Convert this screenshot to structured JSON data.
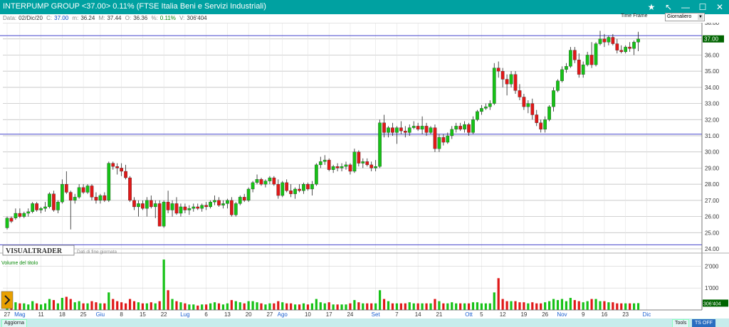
{
  "window": {
    "title": "INTERPUMP GROUP <37.00> 0.11%  (FTSE Italia Beni e Servizi Industriali)",
    "buttons": [
      {
        "name": "star-icon",
        "glyph": "★"
      },
      {
        "name": "arrow-icon",
        "glyph": "↖"
      },
      {
        "name": "minimize-icon",
        "glyph": "—"
      },
      {
        "name": "maximize-icon",
        "glyph": "☐"
      },
      {
        "name": "close-icon",
        "glyph": "✕"
      }
    ]
  },
  "info": {
    "data_label": "Data:",
    "data_value": "02/Dic/20",
    "c_label": "C:",
    "c_value": "37.00",
    "m_label": "m:",
    "m_value": "36.24",
    "mx_label": "M:",
    "mx_value": "37.44",
    "o_label": "O:",
    "o_value": "36.36",
    "pct_label": "%:",
    "pct_value": "0.11%",
    "v_label": "V:",
    "v_value": "306'404"
  },
  "timeframe": {
    "label": "Time Frame",
    "selected": "Giornaliero"
  },
  "brand": {
    "logo": "VISUALTRADER",
    "note": "Dati di fine giornata"
  },
  "bottom": {
    "aggiorna": "Aggiorna",
    "tools": "Tools",
    "tsoff": "TS OFF"
  },
  "colors": {
    "up": "#16c216",
    "down": "#e01818",
    "hline": "#4444cc",
    "grid": "#b8b8b8",
    "price_tag": "#006400",
    "vol_tag": "#006400"
  },
  "chart_data": {
    "type": "candlestick",
    "price_axis": {
      "min": 24.0,
      "max": 38.0,
      "ticks": [
        "24.00",
        "25.00",
        "26.00",
        "27.00",
        "28.00",
        "29.00",
        "30.00",
        "31.00",
        "32.00",
        "33.00",
        "34.00",
        "35.00",
        "36.00",
        "37.00",
        "38.00"
      ]
    },
    "last_price_label": "37.00",
    "horizontal_lines": [
      37.2,
      31.1,
      24.25
    ],
    "volume_panel": {
      "title": "Volume del titolo",
      "ticks": [
        "2'000",
        "1'000"
      ],
      "last_label": "306'404"
    },
    "x_labels": [
      {
        "label": "27",
        "i": 0
      },
      {
        "label": "Mag",
        "i": 3,
        "month": true
      },
      {
        "label": "11",
        "i": 8
      },
      {
        "label": "18",
        "i": 13
      },
      {
        "label": "25",
        "i": 18
      },
      {
        "label": "Giu",
        "i": 22,
        "month": true
      },
      {
        "label": "8",
        "i": 27
      },
      {
        "label": "15",
        "i": 32
      },
      {
        "label": "22",
        "i": 37
      },
      {
        "label": "Lug",
        "i": 42,
        "month": true
      },
      {
        "label": "6",
        "i": 47
      },
      {
        "label": "13",
        "i": 52
      },
      {
        "label": "20",
        "i": 57
      },
      {
        "label": "27",
        "i": 62
      },
      {
        "label": "Ago",
        "i": 65,
        "month": true
      },
      {
        "label": "10",
        "i": 71
      },
      {
        "label": "17",
        "i": 76
      },
      {
        "label": "24",
        "i": 81
      },
      {
        "label": "Set",
        "i": 87,
        "month": true
      },
      {
        "label": "7",
        "i": 92
      },
      {
        "label": "14",
        "i": 97
      },
      {
        "label": "21",
        "i": 102
      },
      {
        "label": "Ott",
        "i": 109,
        "month": true
      },
      {
        "label": "5",
        "i": 112
      },
      {
        "label": "12",
        "i": 117
      },
      {
        "label": "19",
        "i": 122
      },
      {
        "label": "26",
        "i": 127
      },
      {
        "label": "Nov",
        "i": 131,
        "month": true
      },
      {
        "label": "9",
        "i": 136
      },
      {
        "label": "16",
        "i": 141
      },
      {
        "label": "23",
        "i": 146
      },
      {
        "label": "Dic",
        "i": 151,
        "month": true
      }
    ],
    "candles": [
      [
        25.3,
        26.0,
        25.2,
        25.9,
        0.4
      ],
      [
        25.9,
        26.0,
        25.6,
        25.7,
        0.3
      ],
      [
        25.9,
        26.5,
        25.8,
        26.2,
        0.35
      ],
      [
        26.2,
        26.5,
        25.9,
        26.0,
        0.3
      ],
      [
        26.0,
        26.3,
        25.9,
        26.2,
        0.3
      ],
      [
        26.2,
        26.5,
        26.0,
        26.3,
        0.25
      ],
      [
        26.3,
        26.9,
        26.2,
        26.8,
        0.4
      ],
      [
        26.8,
        26.9,
        26.3,
        26.4,
        0.3
      ],
      [
        26.4,
        26.6,
        26.2,
        26.5,
        0.25
      ],
      [
        26.5,
        26.9,
        26.3,
        26.6,
        0.3
      ],
      [
        26.6,
        27.5,
        26.5,
        27.4,
        0.5
      ],
      [
        27.4,
        27.6,
        26.3,
        26.4,
        0.45
      ],
      [
        26.4,
        27.0,
        26.2,
        26.9,
        0.3
      ],
      [
        26.9,
        28.3,
        26.8,
        28.0,
        0.55
      ],
      [
        28.0,
        28.8,
        27.4,
        27.5,
        0.6
      ],
      [
        27.5,
        27.6,
        25.2,
        27.0,
        0.5
      ],
      [
        27.0,
        27.4,
        26.8,
        27.2,
        0.35
      ],
      [
        27.2,
        28.0,
        27.1,
        27.8,
        0.4
      ],
      [
        27.8,
        28.0,
        27.4,
        27.5,
        0.3
      ],
      [
        27.5,
        28.0,
        27.4,
        27.9,
        0.3
      ],
      [
        27.9,
        28.0,
        27.0,
        27.2,
        0.4
      ],
      [
        27.2,
        27.5,
        26.8,
        27.0,
        0.35
      ],
      [
        27.0,
        27.4,
        26.8,
        27.3,
        0.3
      ],
      [
        27.3,
        27.5,
        26.9,
        27.0,
        0.3
      ],
      [
        27.0,
        29.4,
        26.9,
        29.3,
        0.8
      ],
      [
        29.3,
        29.4,
        28.9,
        29.1,
        0.5
      ],
      [
        29.1,
        29.3,
        28.6,
        29.0,
        0.4
      ],
      [
        29.0,
        29.3,
        28.5,
        28.8,
        0.35
      ],
      [
        28.8,
        29.2,
        28.3,
        28.4,
        0.3
      ],
      [
        28.4,
        28.5,
        26.9,
        27.0,
        0.5
      ],
      [
        27.0,
        27.2,
        26.4,
        26.6,
        0.4
      ],
      [
        26.6,
        27.0,
        26.0,
        26.8,
        0.35
      ],
      [
        26.8,
        27.0,
        26.4,
        26.5,
        0.3
      ],
      [
        26.5,
        27.2,
        26.0,
        27.0,
        0.3
      ],
      [
        27.0,
        27.3,
        26.5,
        26.6,
        0.35
      ],
      [
        26.6,
        27.0,
        25.9,
        26.8,
        0.3
      ],
      [
        26.8,
        27.0,
        25.4,
        25.4,
        0.4
      ],
      [
        25.4,
        27.0,
        25.3,
        26.9,
        2.3
      ],
      [
        26.9,
        27.6,
        26.2,
        26.4,
        0.9
      ],
      [
        26.4,
        27.0,
        26.0,
        26.8,
        0.5
      ],
      [
        26.8,
        27.2,
        26.1,
        26.2,
        0.4
      ],
      [
        26.2,
        26.8,
        26.0,
        26.6,
        0.35
      ],
      [
        26.6,
        26.8,
        26.2,
        26.4,
        0.3
      ],
      [
        26.4,
        26.7,
        26.1,
        26.5,
        0.25
      ],
      [
        26.5,
        26.8,
        26.3,
        26.6,
        0.25
      ],
      [
        26.6,
        26.8,
        26.4,
        26.5,
        0.2
      ],
      [
        26.5,
        26.8,
        26.3,
        26.7,
        0.25
      ],
      [
        26.7,
        26.9,
        26.4,
        26.6,
        0.25
      ],
      [
        26.6,
        27.0,
        26.5,
        26.9,
        0.3
      ],
      [
        26.9,
        27.3,
        26.7,
        27.0,
        0.35
      ],
      [
        27.0,
        27.2,
        26.6,
        26.7,
        0.3
      ],
      [
        26.7,
        27.0,
        26.5,
        26.8,
        0.25
      ],
      [
        26.8,
        27.1,
        26.5,
        27.0,
        0.3
      ],
      [
        27.0,
        27.2,
        26.0,
        26.1,
        0.45
      ],
      [
        26.1,
        26.9,
        26.0,
        26.8,
        0.4
      ],
      [
        26.8,
        27.3,
        26.7,
        27.2,
        0.35
      ],
      [
        27.2,
        27.4,
        26.9,
        27.0,
        0.3
      ],
      [
        27.0,
        27.8,
        26.9,
        27.7,
        0.4
      ],
      [
        27.7,
        28.2,
        27.5,
        28.1,
        0.4
      ],
      [
        28.1,
        28.6,
        28.0,
        28.3,
        0.35
      ],
      [
        28.3,
        28.4,
        27.9,
        28.0,
        0.3
      ],
      [
        28.0,
        28.3,
        27.8,
        28.2,
        0.25
      ],
      [
        28.2,
        28.5,
        28.0,
        28.4,
        0.3
      ],
      [
        28.4,
        28.5,
        27.9,
        28.0,
        0.3
      ],
      [
        28.0,
        28.3,
        27.1,
        27.3,
        0.4
      ],
      [
        27.3,
        28.2,
        27.2,
        28.1,
        0.35
      ],
      [
        28.1,
        28.3,
        27.5,
        27.6,
        0.3
      ],
      [
        27.6,
        28.0,
        27.2,
        27.4,
        0.3
      ],
      [
        27.4,
        27.8,
        27.1,
        27.7,
        0.25
      ],
      [
        27.7,
        28.0,
        27.5,
        27.6,
        0.25
      ],
      [
        27.6,
        28.1,
        27.4,
        28.0,
        0.3
      ],
      [
        28.0,
        28.1,
        27.6,
        27.7,
        0.25
      ],
      [
        27.7,
        28.2,
        27.3,
        28.0,
        0.3
      ],
      [
        28.0,
        29.3,
        27.9,
        29.2,
        0.5
      ],
      [
        29.2,
        29.7,
        29.0,
        29.4,
        0.35
      ],
      [
        29.4,
        29.8,
        29.2,
        29.5,
        0.3
      ],
      [
        29.5,
        29.6,
        28.8,
        28.9,
        0.35
      ],
      [
        28.9,
        29.2,
        28.7,
        29.1,
        0.25
      ],
      [
        29.1,
        29.3,
        28.8,
        29.0,
        0.25
      ],
      [
        29.0,
        29.3,
        28.8,
        29.1,
        0.25
      ],
      [
        29.1,
        29.4,
        28.9,
        29.2,
        0.25
      ],
      [
        29.2,
        29.3,
        28.6,
        28.8,
        0.3
      ],
      [
        28.8,
        30.2,
        28.7,
        30.0,
        0.45
      ],
      [
        30.0,
        30.1,
        29.1,
        29.3,
        0.35
      ],
      [
        29.3,
        29.6,
        29.0,
        29.4,
        0.3
      ],
      [
        29.4,
        29.6,
        29.1,
        29.2,
        0.3
      ],
      [
        29.2,
        29.4,
        28.8,
        29.0,
        0.3
      ],
      [
        29.0,
        29.5,
        28.8,
        29.1,
        0.3
      ],
      [
        29.1,
        32.0,
        29.0,
        31.8,
        0.9
      ],
      [
        31.8,
        32.3,
        30.9,
        31.2,
        0.5
      ],
      [
        31.2,
        31.6,
        30.9,
        31.5,
        0.4
      ],
      [
        31.5,
        31.8,
        31.0,
        31.2,
        0.3
      ],
      [
        31.2,
        31.6,
        30.5,
        31.5,
        0.3
      ],
      [
        31.5,
        31.9,
        31.1,
        31.3,
        0.3
      ],
      [
        31.3,
        31.6,
        30.9,
        31.2,
        0.3
      ],
      [
        31.2,
        31.7,
        31.0,
        31.5,
        0.35
      ],
      [
        31.5,
        31.9,
        31.4,
        31.6,
        0.3
      ],
      [
        31.6,
        31.8,
        31.3,
        31.4,
        0.3
      ],
      [
        31.4,
        32.2,
        31.1,
        31.6,
        0.3
      ],
      [
        31.6,
        31.8,
        31.0,
        31.2,
        0.3
      ],
      [
        31.2,
        31.6,
        31.1,
        31.5,
        0.3
      ],
      [
        31.5,
        31.7,
        30.0,
        30.2,
        0.5
      ],
      [
        30.2,
        31.1,
        30.0,
        30.9,
        0.4
      ],
      [
        30.9,
        31.1,
        30.4,
        30.6,
        0.3
      ],
      [
        30.6,
        31.2,
        30.5,
        31.0,
        0.3
      ],
      [
        31.0,
        31.6,
        30.8,
        31.4,
        0.35
      ],
      [
        31.4,
        31.8,
        31.2,
        31.6,
        0.3
      ],
      [
        31.6,
        31.8,
        31.3,
        31.4,
        0.3
      ],
      [
        31.4,
        31.9,
        31.2,
        31.7,
        0.3
      ],
      [
        31.7,
        31.8,
        31.0,
        31.2,
        0.3
      ],
      [
        31.2,
        32.2,
        31.1,
        32.0,
        0.35
      ],
      [
        32.0,
        32.6,
        31.9,
        32.5,
        0.35
      ],
      [
        32.5,
        32.9,
        32.3,
        32.7,
        0.3
      ],
      [
        32.7,
        33.0,
        32.6,
        32.8,
        0.3
      ],
      [
        32.8,
        33.2,
        32.6,
        33.0,
        0.3
      ],
      [
        33.0,
        35.5,
        32.9,
        35.2,
        0.8
      ],
      [
        35.2,
        35.6,
        34.6,
        35.0,
        1.45
      ],
      [
        35.0,
        35.2,
        34.0,
        34.5,
        0.5
      ],
      [
        34.5,
        34.8,
        33.5,
        34.2,
        0.4
      ],
      [
        34.2,
        35.0,
        34.0,
        34.8,
        0.4
      ],
      [
        34.8,
        35.0,
        33.6,
        33.8,
        0.4
      ],
      [
        33.8,
        34.2,
        33.2,
        33.4,
        0.35
      ],
      [
        33.4,
        33.6,
        32.6,
        32.8,
        0.35
      ],
      [
        32.8,
        33.2,
        32.4,
        33.0,
        0.3
      ],
      [
        33.0,
        33.3,
        32.0,
        32.3,
        0.35
      ],
      [
        32.3,
        32.6,
        31.6,
        31.8,
        0.3
      ],
      [
        31.8,
        32.0,
        31.2,
        31.4,
        0.3
      ],
      [
        31.4,
        32.2,
        31.2,
        32.0,
        0.35
      ],
      [
        32.0,
        32.9,
        31.9,
        32.8,
        0.4
      ],
      [
        32.8,
        34.0,
        32.5,
        33.8,
        0.5
      ],
      [
        33.8,
        34.5,
        33.7,
        34.4,
        0.45
      ],
      [
        34.4,
        35.3,
        34.3,
        35.1,
        0.5
      ],
      [
        35.1,
        35.5,
        34.9,
        35.3,
        0.4
      ],
      [
        35.3,
        36.5,
        35.2,
        36.3,
        0.55
      ],
      [
        36.3,
        36.5,
        35.5,
        35.7,
        0.45
      ],
      [
        35.7,
        36.1,
        34.6,
        34.8,
        0.4
      ],
      [
        34.8,
        35.6,
        34.6,
        35.4,
        0.35
      ],
      [
        35.4,
        36.2,
        35.3,
        36.0,
        0.4
      ],
      [
        36.0,
        36.8,
        35.2,
        35.4,
        0.5
      ],
      [
        35.4,
        36.8,
        35.3,
        36.7,
        0.5
      ],
      [
        36.7,
        37.5,
        36.6,
        37.0,
        0.4
      ],
      [
        37.0,
        37.3,
        36.5,
        36.8,
        0.4
      ],
      [
        36.8,
        37.2,
        36.6,
        37.1,
        0.35
      ],
      [
        37.1,
        37.3,
        36.6,
        36.7,
        0.35
      ],
      [
        36.7,
        37.0,
        36.1,
        36.3,
        0.3
      ],
      [
        36.3,
        36.6,
        36.1,
        36.2,
        0.3
      ],
      [
        36.2,
        36.6,
        36.1,
        36.5,
        0.3
      ],
      [
        36.5,
        36.8,
        36.2,
        36.4,
        0.3
      ],
      [
        36.4,
        36.9,
        36.0,
        36.8,
        0.3
      ],
      [
        36.8,
        37.44,
        36.24,
        37.0,
        0.31
      ]
    ]
  }
}
